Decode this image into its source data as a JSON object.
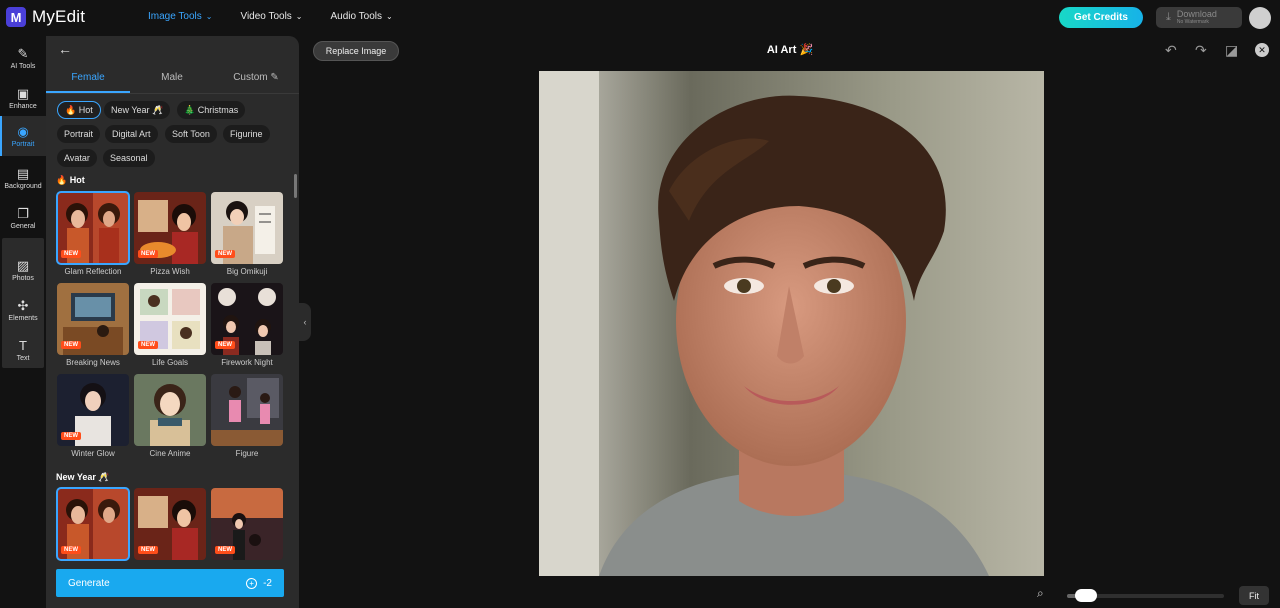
{
  "app": {
    "name": "MyEdit"
  },
  "topnav": [
    {
      "label": "Image Tools",
      "active": true
    },
    {
      "label": "Video Tools",
      "active": false
    },
    {
      "label": "Audio Tools",
      "active": false
    }
  ],
  "header": {
    "get_credits": "Get Credits",
    "download": "Download",
    "download_sub": "No Watermark"
  },
  "rail": [
    {
      "label": "AI Tools",
      "icon": "magic-wand-icon"
    },
    {
      "label": "Enhance",
      "icon": "image-enhance-icon"
    },
    {
      "label": "Portrait",
      "icon": "portrait-icon",
      "active": true
    },
    {
      "label": "Background",
      "icon": "background-icon"
    },
    {
      "label": "General",
      "icon": "general-icon"
    },
    {
      "label": "Photos",
      "icon": "photos-icon"
    },
    {
      "label": "Elements",
      "icon": "elements-icon"
    },
    {
      "label": "Text",
      "icon": "text-icon"
    }
  ],
  "panel": {
    "tabs": [
      {
        "label": "Female"
      },
      {
        "label": "Male"
      },
      {
        "label": "Custom"
      }
    ],
    "active_tab": 0,
    "chips": [
      {
        "label": "Hot",
        "emoji": "🔥",
        "active": true
      },
      {
        "label": "New Year",
        "emoji": "🥂"
      },
      {
        "label": "Christmas",
        "emoji": "🎄"
      },
      {
        "label": "Portrait"
      },
      {
        "label": "Digital Art"
      },
      {
        "label": "Soft Toon"
      },
      {
        "label": "Figurine"
      },
      {
        "label": "Avatar"
      },
      {
        "label": "Seasonal"
      }
    ],
    "sections": [
      {
        "title": "Hot",
        "emoji": "🔥"
      },
      {
        "title": "New Year",
        "emoji": "🥂"
      }
    ],
    "new_badge": "NEW",
    "hot_items": [
      {
        "label": "Glam Reflection",
        "new": true,
        "selected": true
      },
      {
        "label": "Pizza Wish",
        "new": true
      },
      {
        "label": "Big Omikuji",
        "new": true
      },
      {
        "label": "Breaking News",
        "new": true
      },
      {
        "label": "Life Goals",
        "new": true
      },
      {
        "label": "Firework Night",
        "new": true
      },
      {
        "label": "Winter Glow",
        "new": true
      },
      {
        "label": "Cine Anime",
        "new": false
      },
      {
        "label": "Figure",
        "new": false
      }
    ],
    "newyear_items": [
      {
        "new": true,
        "selected": true
      },
      {
        "new": true
      },
      {
        "new": true
      }
    ],
    "generate": {
      "label": "Generate",
      "cost": "-2"
    }
  },
  "canvas": {
    "replace_image": "Replace Image",
    "title": "AI Art",
    "title_emoji": "🎉",
    "fit": "Fit",
    "zoom": 0.05
  },
  "colors": {
    "accent": "#3aa6ff",
    "badge": "#ff4d1a",
    "generate": "#19a9ef"
  }
}
